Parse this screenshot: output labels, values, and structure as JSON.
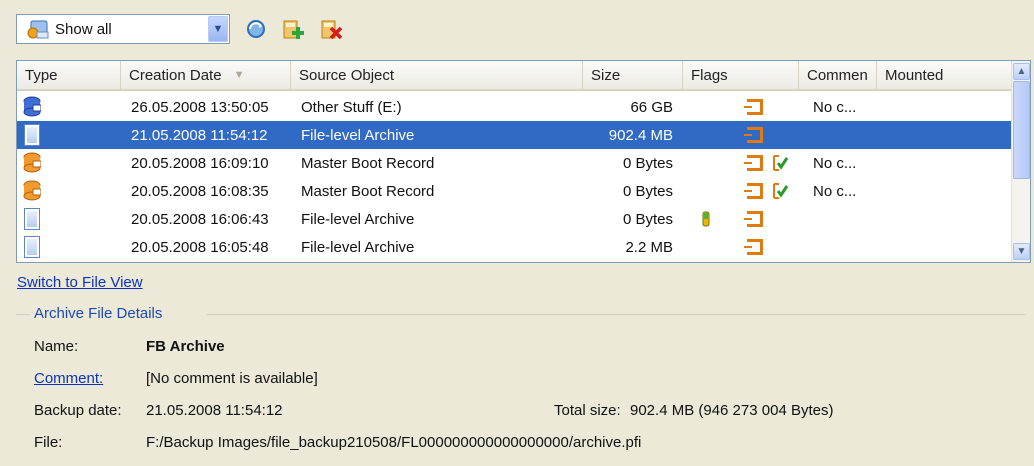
{
  "toolbar": {
    "filter_value": "Show all",
    "icons": [
      "filter-icon",
      "refresh-icon",
      "add-archive-icon",
      "delete-archive-icon"
    ]
  },
  "list": {
    "columns": [
      "Type",
      "Creation Date",
      "Source Object",
      "Size",
      "Flags",
      "Commen",
      "Mounted"
    ],
    "sort_column": "Creation Date",
    "rows": [
      {
        "type_icon": "partition-archive-icon",
        "date": "26.05.2008 13:50:05",
        "source": "Other Stuff (E:)",
        "size": "66 GB",
        "flags": [
          "archive-flag"
        ],
        "comment": "No c...",
        "mounted": "",
        "selected": false
      },
      {
        "type_icon": "file-archive-icon",
        "date": "21.05.2008 11:54:12",
        "source": "File-level Archive",
        "size": "902.4 MB",
        "flags": [
          "archive-flag"
        ],
        "comment": "",
        "mounted": "",
        "selected": true
      },
      {
        "type_icon": "mbr-archive-icon",
        "date": "20.05.2008 16:09:10",
        "source": "Master Boot Record",
        "size": "0 Bytes",
        "flags": [
          "archive-flag",
          "verified-flag"
        ],
        "comment": "No c...",
        "mounted": "",
        "selected": false
      },
      {
        "type_icon": "mbr-archive-icon",
        "date": "20.05.2008 16:08:35",
        "source": "Master Boot Record",
        "size": "0 Bytes",
        "flags": [
          "archive-flag",
          "verified-flag"
        ],
        "comment": "No c...",
        "mounted": "",
        "selected": false
      },
      {
        "type_icon": "file-archive-icon",
        "date": "20.05.2008 16:06:43",
        "source": "File-level Archive",
        "size": "0 Bytes",
        "flags": [
          "incremental-flag",
          "archive-flag"
        ],
        "comment": "",
        "mounted": "",
        "selected": false
      },
      {
        "type_icon": "file-archive-icon",
        "date": "20.05.2008 16:05:48",
        "source": "File-level Archive",
        "size": "2.2 MB",
        "flags": [
          "archive-flag"
        ],
        "comment": "",
        "mounted": "",
        "selected": false
      }
    ]
  },
  "switch_link": "Switch to File View",
  "details": {
    "title": "Archive File Details",
    "name_label": "Name:",
    "name_value": "FB Archive",
    "comment_label": "Comment:",
    "comment_value": "[No comment is available]",
    "backup_date_label": "Backup date:",
    "backup_date_value": "21.05.2008 11:54:12",
    "total_size_label": "Total size:",
    "total_size_value": "902.4 MB (946 273 004 Bytes)",
    "file_label": "File:",
    "file_value": "F:/Backup Images/file_backup210508/FL000000000000000000/archive.pfi"
  },
  "colors": {
    "selection": "#316ac5",
    "link": "#0b33c0",
    "accent_orange": "#e07b12",
    "window_bg": "#ece9d8"
  }
}
